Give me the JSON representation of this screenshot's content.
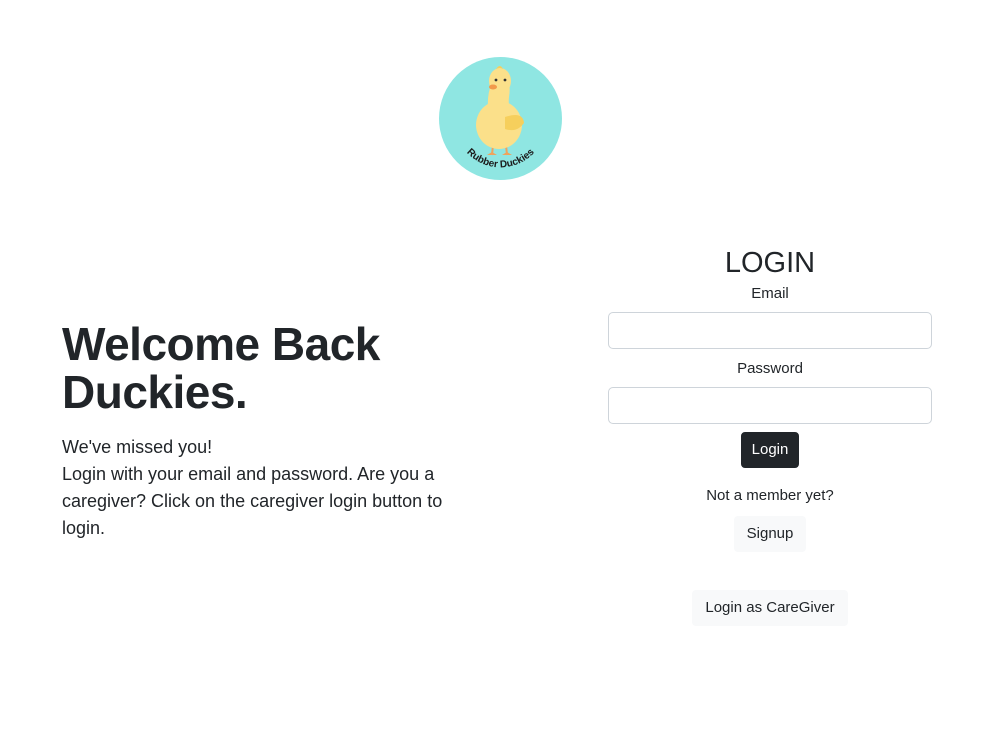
{
  "logo": {
    "text": "Rubber Duckies",
    "background_color": "#8fe6e2",
    "icon": "duck-icon"
  },
  "welcome": {
    "heading": "Welcome Back Duckies.",
    "line1": "We've missed you!",
    "line2": "Login with your email and password. Are you a caregiver? Click on the caregiver login button to login."
  },
  "login": {
    "title": "LOGIN",
    "email_label": "Email",
    "email_value": "",
    "password_label": "Password",
    "password_value": "",
    "login_button": "Login",
    "not_member_text": "Not a member yet?",
    "signup_button": "Signup",
    "caregiver_button": "Login as CareGiver"
  },
  "colors": {
    "primary_button": "#212529",
    "light_button": "#f8f9fa",
    "text": "#212529"
  }
}
